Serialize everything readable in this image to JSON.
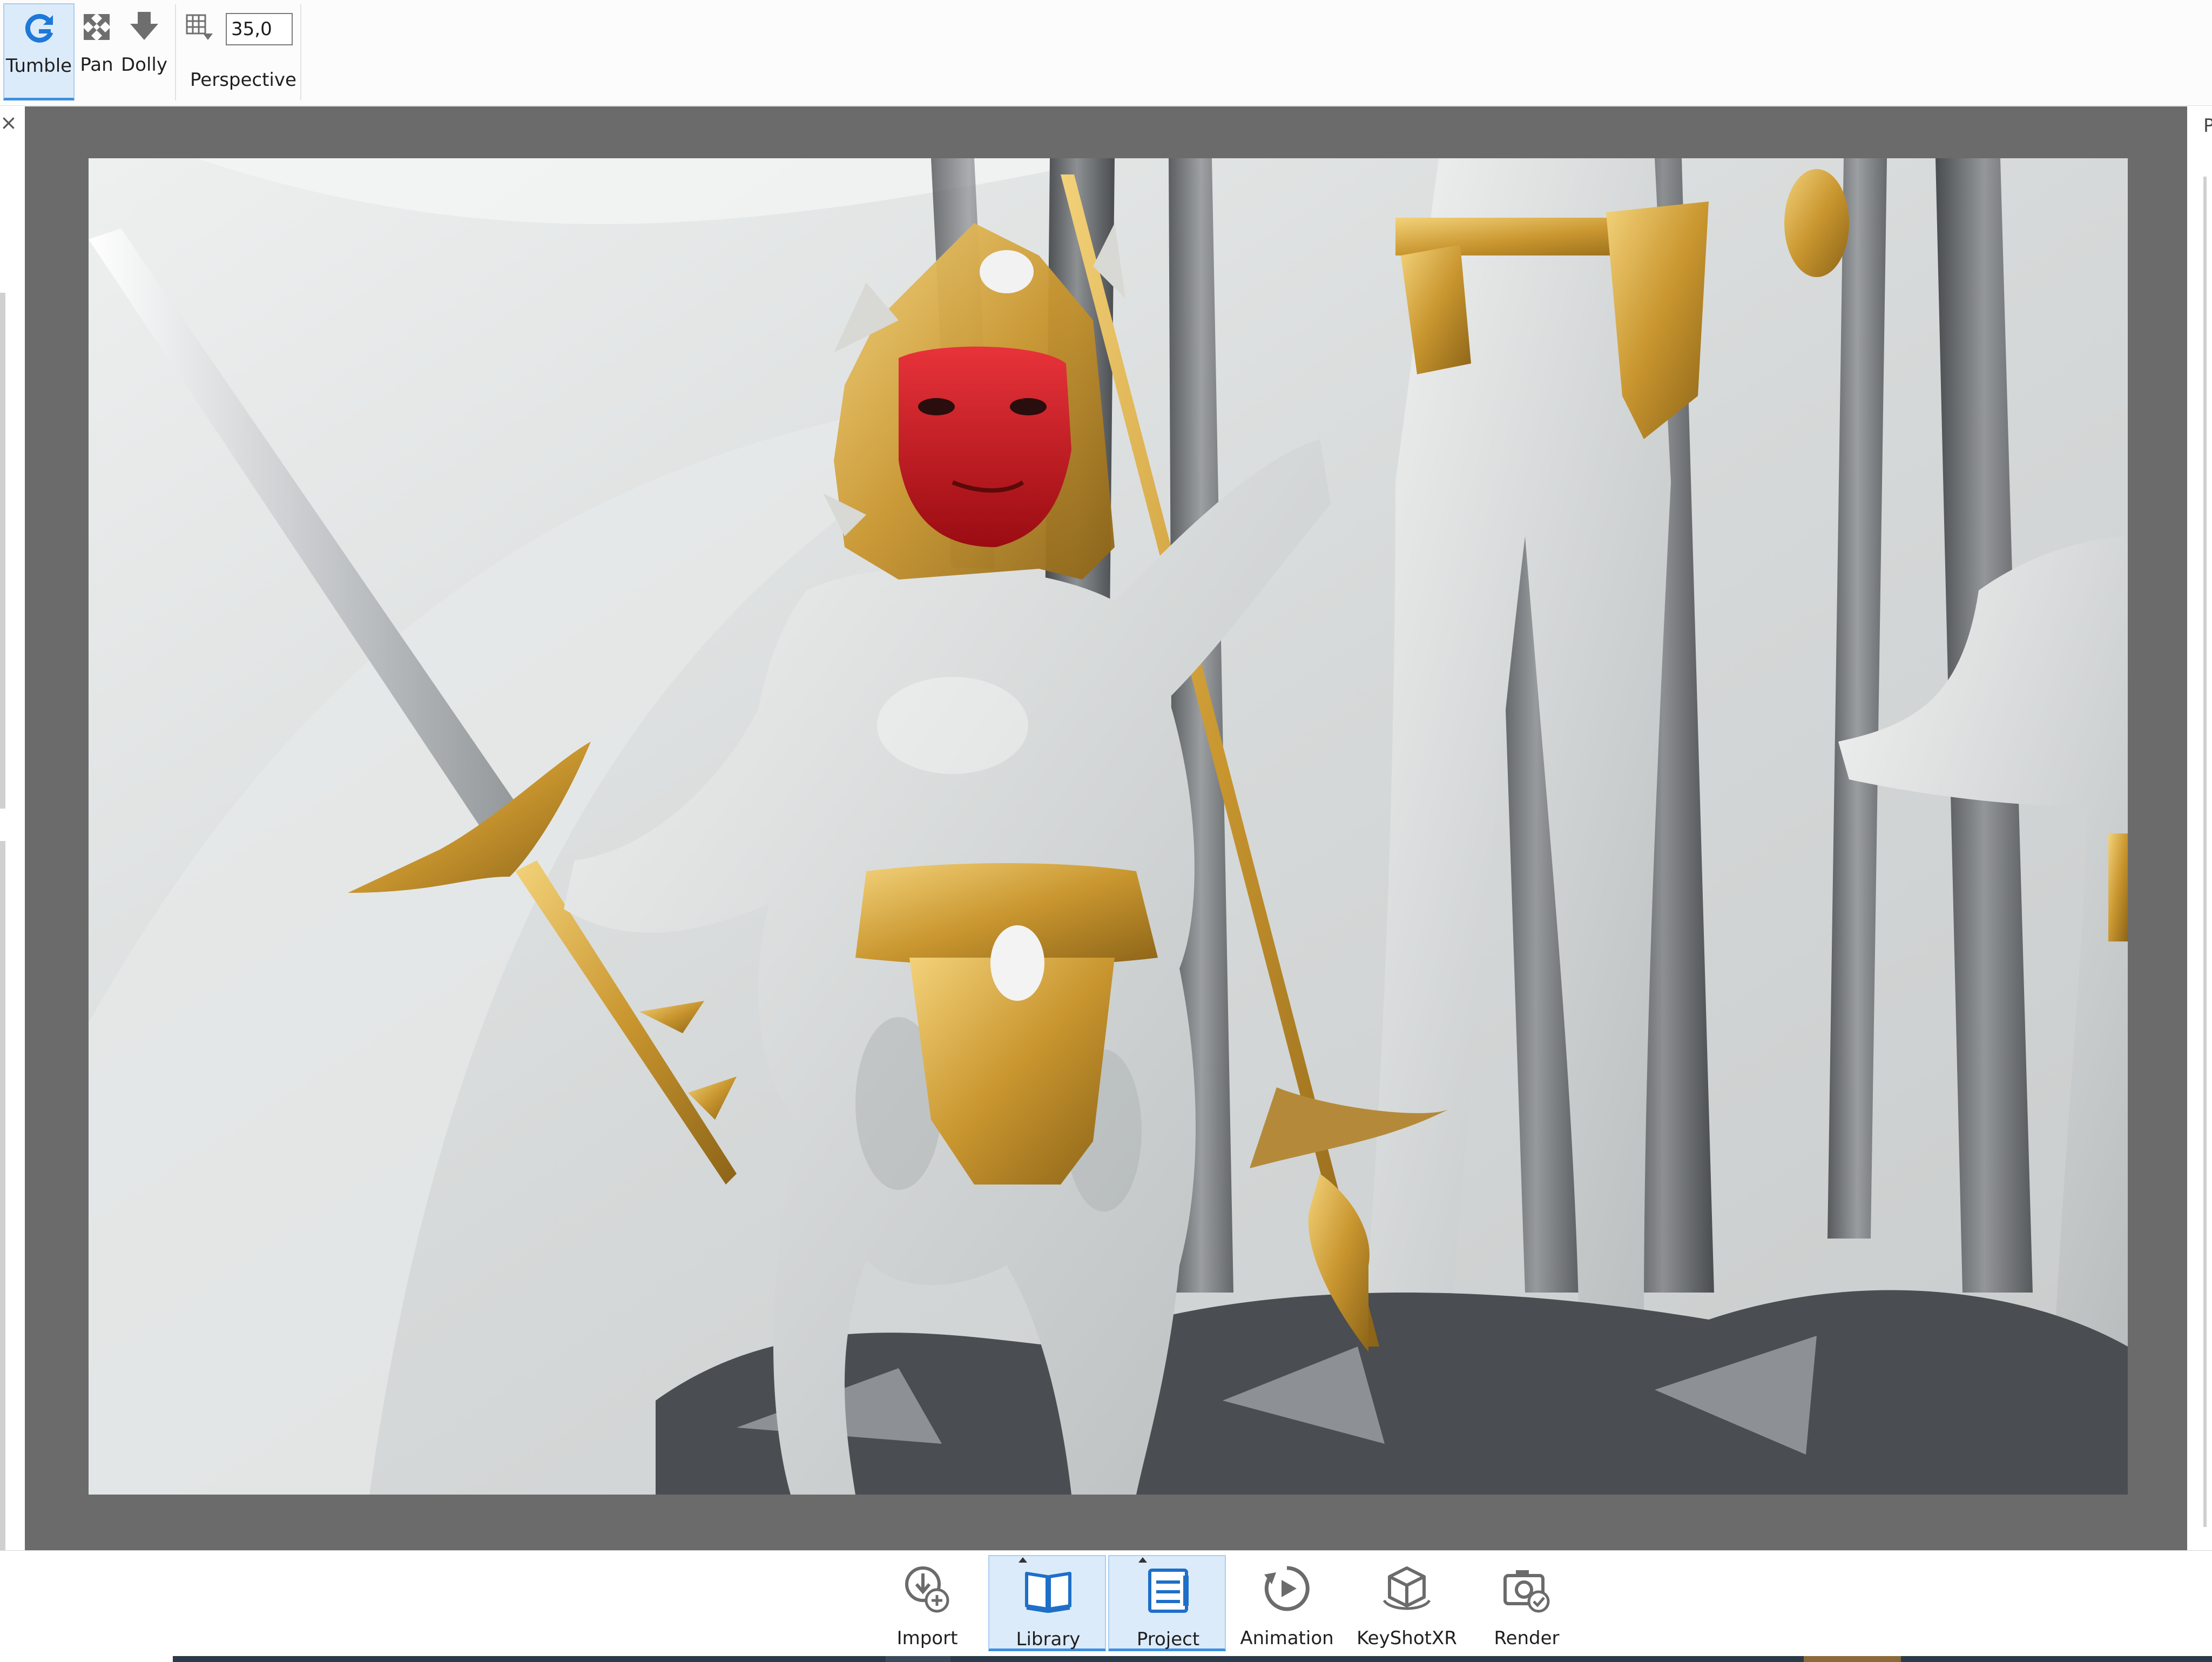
{
  "toolbar": {
    "tumble_label": "Tumble",
    "pan_label": "Pan",
    "dolly_label": "Dolly",
    "fov_value": "35,0",
    "perspective_label": "Perspective"
  },
  "left_panel": {
    "close_glyph": "×"
  },
  "right_panel": {
    "tab_letter": "P"
  },
  "viewport": {
    "background_color": "#6b6b6b",
    "scene_description_colors": {
      "marble_white": "#e4e6e6",
      "gold": "#c9962f",
      "mask_red": "#c8141c",
      "dark_metal": "#3a3d40"
    }
  },
  "ribbon": {
    "buttons": [
      {
        "label": "Import",
        "icon": "import-icon",
        "active": false
      },
      {
        "label": "Library",
        "icon": "library-book-icon",
        "active": true
      },
      {
        "label": "Project",
        "icon": "project-list-icon",
        "active": true
      },
      {
        "label": "Animation",
        "icon": "animation-play-icon",
        "active": false
      },
      {
        "label": "KeyShotXR",
        "icon": "keyshotxr-cube-icon",
        "active": false
      },
      {
        "label": "Render",
        "icon": "render-camera-icon",
        "active": false
      }
    ]
  },
  "accent_color": "#3d8fe0"
}
